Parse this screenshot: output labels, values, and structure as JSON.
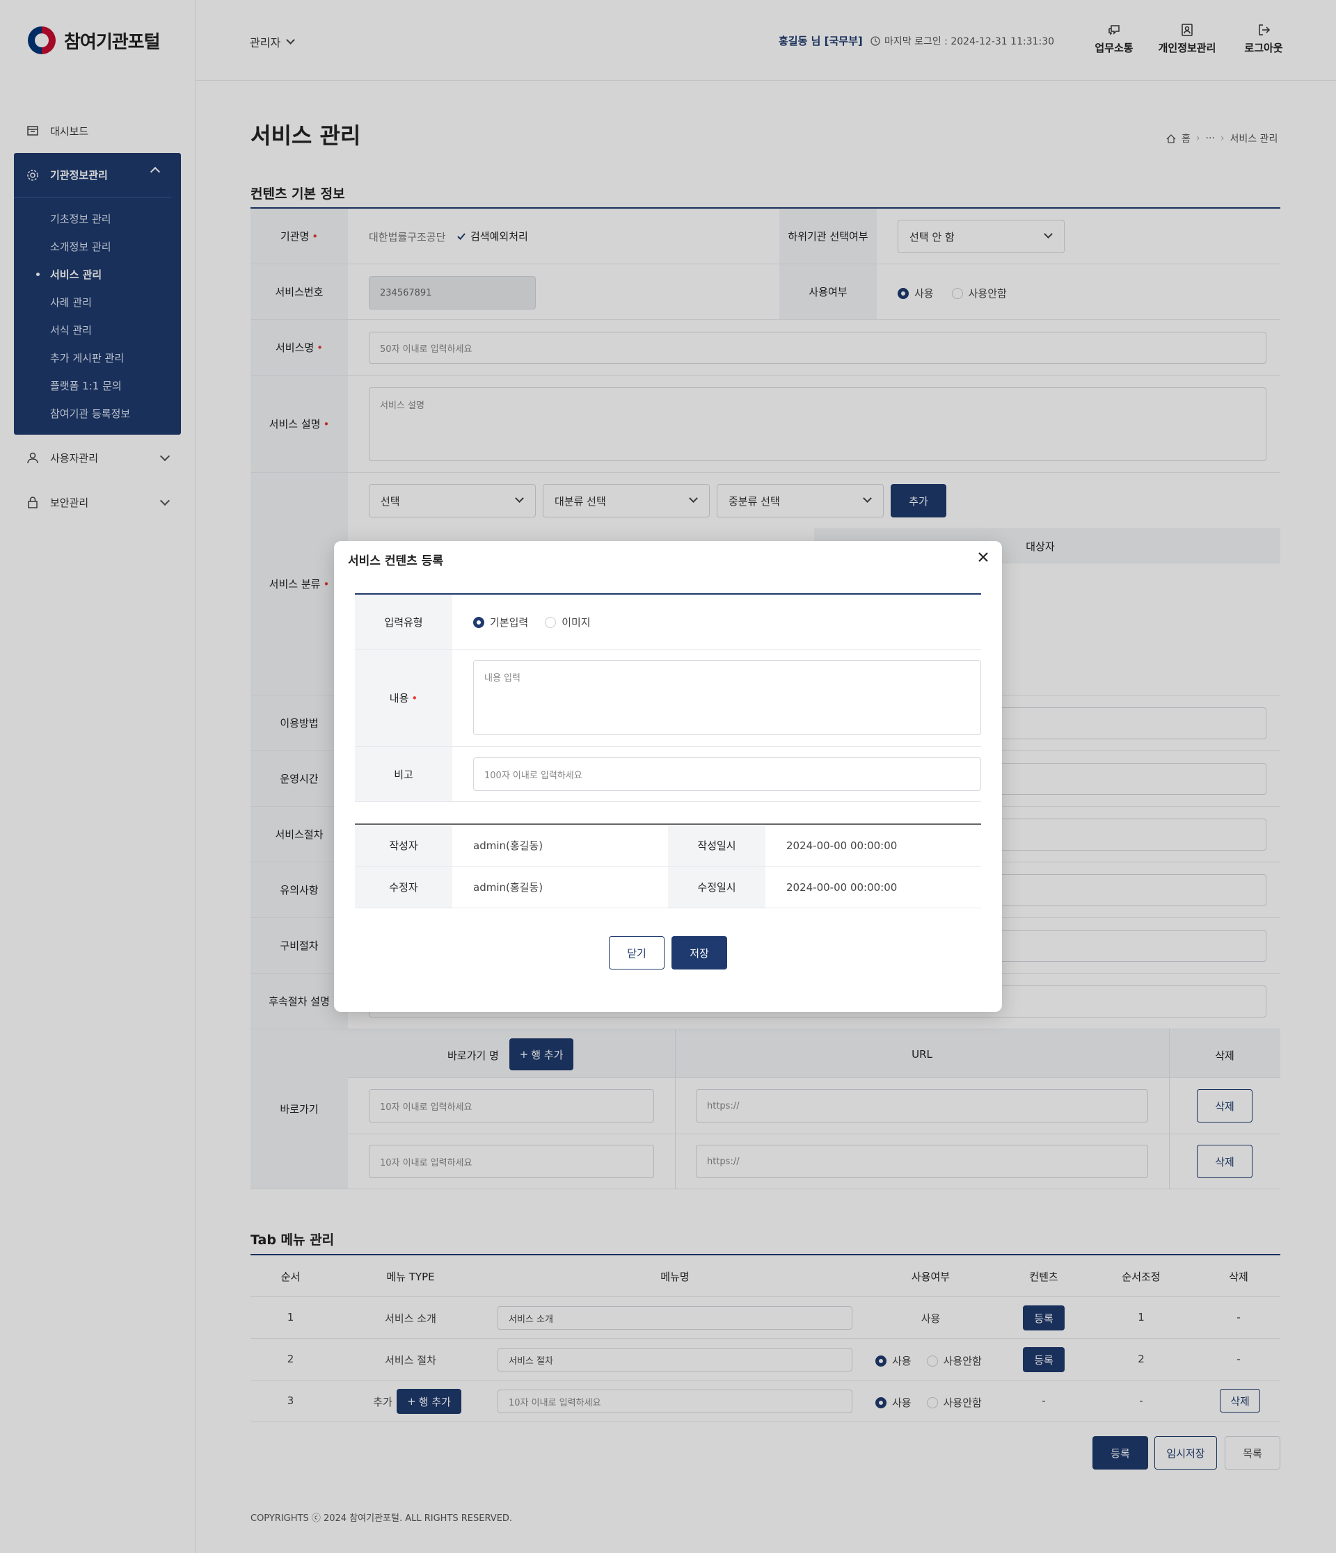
{
  "app": {
    "logo_text": "참여기관포털"
  },
  "header": {
    "role": "관리자",
    "user": "홍길동 님 [국무부]",
    "last_login": "마지막 로그인 : 2024-12-31 11:31:30",
    "buttons": [
      "업무소통",
      "개인정보관리",
      "로그아웃"
    ]
  },
  "sidebar": {
    "dashboard": "대시보드",
    "active_section": "기관정보관리",
    "sub_items": [
      "기초정보 관리",
      "소개정보 관리",
      "서비스 관리",
      "사례 관리",
      "서식 관리",
      "추가 게시판 관리",
      "플랫폼 1:1 문의",
      "참여기관 등록정보"
    ],
    "current_sub": "서비스 관리",
    "user_mgmt": "사용자관리",
    "security_mgmt": "보안관리"
  },
  "page": {
    "title": "서비스 관리",
    "breadcrumb": [
      "홈",
      "···",
      "서비스 관리"
    ]
  },
  "basic_info": {
    "section_title": "컨텐츠 기본 정보",
    "org_label": "기관명",
    "org_value": "대한법률구조공단",
    "exclude_label": "검색예외처리",
    "sub_org_label": "하위기관 선택여부",
    "sub_org_value": "선택 안 함",
    "service_no_label": "서비스번호",
    "service_no_value": "234567891",
    "use_label": "사용여부",
    "use_options": [
      "사용",
      "사용안함"
    ],
    "service_name_label": "서비스명",
    "service_name_placeholder": "50자 이내로 입력하세요",
    "service_desc_label": "서비스 설명",
    "service_desc_placeholder": "서비스 설명",
    "category_label": "서비스 분류",
    "category_selects": [
      "선택",
      "대분류 선택",
      "중분류 선택"
    ],
    "add_button": "추가",
    "target_header": "대상자",
    "other_labels": [
      "이용방법",
      "운영시간",
      "서비스절차",
      "유의사항",
      "구비절차",
      "후속절차 설명"
    ]
  },
  "shortcut": {
    "label": "바로가기",
    "name_header": "바로가기 명",
    "add_row": "행 추가",
    "url_header": "URL",
    "delete_header": "삭제",
    "rows": [
      {
        "name_placeholder": "10자 이내로 입력하세요",
        "url_placeholder": "https://",
        "delete": "삭제"
      },
      {
        "name_placeholder": "10자 이내로 입력하세요",
        "url_placeholder": "https://",
        "delete": "삭제"
      }
    ]
  },
  "tab_menu": {
    "section_title": "Tab 메뉴 관리",
    "headers": [
      "순서",
      "메뉴 TYPE",
      "메뉴명",
      "사용여부",
      "컨텐츠",
      "순서조정",
      "삭제"
    ],
    "rows": [
      {
        "order": "1",
        "type": "서비스 소개",
        "name": "서비스 소개",
        "use": "사용",
        "content": "등록",
        "adjust": "1",
        "del": "-"
      },
      {
        "order": "2",
        "type": "서비스 절차",
        "name": "서비스 절차",
        "use_options": [
          "사용",
          "사용안함"
        ],
        "content": "등록",
        "adjust": "2",
        "del": "-"
      },
      {
        "order": "3",
        "type": "추가",
        "add_row": "행 추가",
        "name_placeholder": "10자 이내로 입력하세요",
        "use_options": [
          "사용",
          "사용안함"
        ],
        "content": "-",
        "adjust": "-",
        "del": "삭제"
      }
    ]
  },
  "actions": {
    "register": "등록",
    "temp_save": "임시저장",
    "list": "목록"
  },
  "footer": "COPYRIGHTS ⓒ 2024 참여기관포털. ALL RIGHTS RESERVED.",
  "modal": {
    "title": "서비스 컨텐츠 등록",
    "input_type_label": "입력유형",
    "input_type_options": [
      "기본입력",
      "이미지"
    ],
    "content_label": "내용",
    "content_placeholder": "내용 입력",
    "note_label": "비고",
    "note_placeholder": "100자 이내로 입력하세요",
    "author_label": "작성자",
    "author_value": "admin(홍길동)",
    "created_label": "작성일시",
    "created_value": "2024-00-00  00:00:00",
    "editor_label": "수정자",
    "editor_value": "admin(홍길동)",
    "modified_label": "수정일시",
    "modified_value": "2024-00-00  00:00:00",
    "close_button": "닫기",
    "save_button": "저장"
  },
  "colors": {
    "primary": "#1f3a6e",
    "required": "#e53935"
  }
}
